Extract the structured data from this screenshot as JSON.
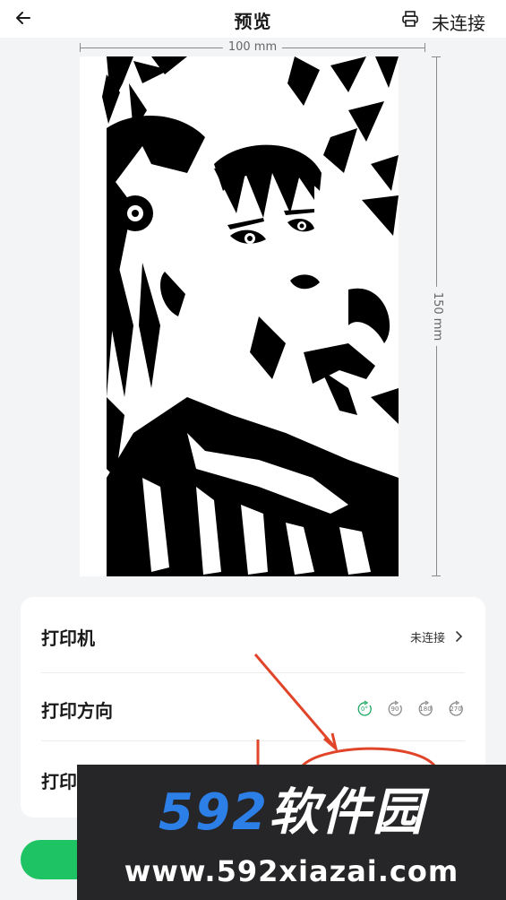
{
  "header": {
    "title": "预览",
    "connection_status": "未连接",
    "back_icon": "arrow-left-icon",
    "printer_icon": "printer-icon"
  },
  "preview": {
    "width_label": "100 mm",
    "height_label": "150 mm"
  },
  "settings": {
    "printer": {
      "label": "打印机",
      "value": "未连接",
      "icon": "chevron-right-icon"
    },
    "orientation": {
      "label": "打印方向",
      "options": [
        "0°",
        "90",
        "180",
        "270"
      ],
      "selected": "0°"
    },
    "row3": {
      "label": "打印"
    }
  },
  "watermark": {
    "brand_num": "592",
    "brand_cn": "软件园",
    "url": "www.592xiazai.com"
  },
  "colors": {
    "accent_green": "#1ec463",
    "annotation_red": "#e0452a",
    "watermark_blue": "#2d7fe8"
  }
}
